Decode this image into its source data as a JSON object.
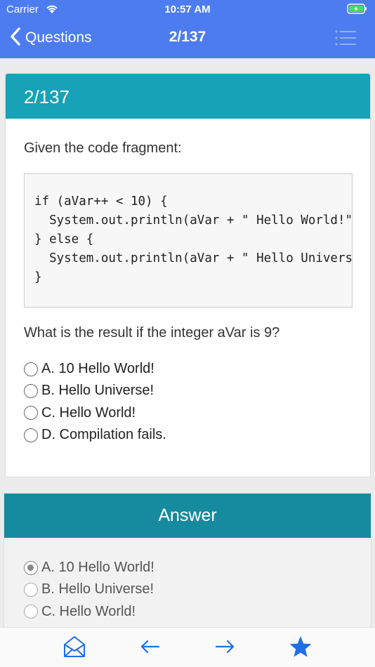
{
  "status_bar": {
    "carrier": "Carrier",
    "time": "10:57 AM"
  },
  "nav": {
    "back_label": "Questions",
    "title": "2/137"
  },
  "question": {
    "header": "2/137",
    "prompt": "Given the code fragment:",
    "code": "if (aVar++ < 10) {\n  System.out.println(aVar + \" Hello World!\");\n} else {\n  System.out.println(aVar + \" Hello Universe!\");\n}",
    "text": "What is the result if the integer aVar is 9?",
    "options": [
      "A. 10 Hello World!",
      "B. Hello Universe!",
      "C. Hello World!",
      "D. Compilation fails."
    ]
  },
  "answer": {
    "header": "Answer",
    "options": [
      "A. 10 Hello World!",
      "B. Hello Universe!",
      "C. Hello World!"
    ],
    "selected_index": 0
  },
  "toolbar": {
    "icons": [
      "mail-icon",
      "arrow-left-icon",
      "arrow-right-icon",
      "star-icon"
    ]
  },
  "colors": {
    "nav_blue": "#4d7cf0",
    "card_header_teal": "#17a2b8",
    "answer_header_teal": "#168a9e",
    "toolbar_icon_blue": "#1f6fe5"
  }
}
